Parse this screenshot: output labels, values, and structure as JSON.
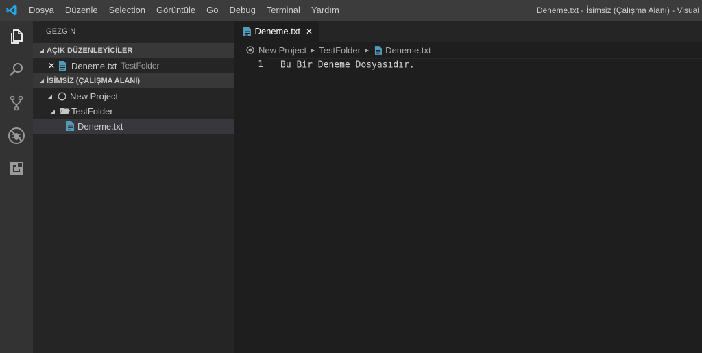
{
  "titlebar": {
    "menu": [
      "Dosya",
      "Düzenle",
      "Selection",
      "Görüntüle",
      "Go",
      "Debug",
      "Terminal",
      "Yardım"
    ],
    "window_title": "Deneme.txt - İsimsiz (Çalışma Alanı) - Visual"
  },
  "activitybar": {
    "icons": [
      "explorer-icon",
      "search-icon",
      "source-control-icon",
      "debug-icon",
      "extensions-icon"
    ]
  },
  "sidebar": {
    "title": "GEZGİN",
    "open_editors": {
      "header": "AÇIK DÜZENLEYİCİLER",
      "items": [
        {
          "name": "Deneme.txt",
          "folder": "TestFolder"
        }
      ]
    },
    "workspace": {
      "header": "İSİMSİZ (ÇALIŞMA ALANI)",
      "project": "New Project",
      "folder": "TestFolder",
      "file": "Deneme.txt"
    }
  },
  "editor": {
    "tab": {
      "label": "Deneme.txt",
      "close": "✕"
    },
    "breadcrumbs": [
      "New Project",
      "TestFolder",
      "Deneme.txt"
    ],
    "lines": [
      {
        "number": "1",
        "text": "Bu Bir Deneme Dosyasıdır."
      }
    ]
  },
  "colors": {
    "accent": "#007acc",
    "file_icon": "#519aba",
    "titlebar": "#3c3c3c",
    "activitybar": "#333333",
    "sidebar": "#252526",
    "editor": "#1e1e1e"
  }
}
